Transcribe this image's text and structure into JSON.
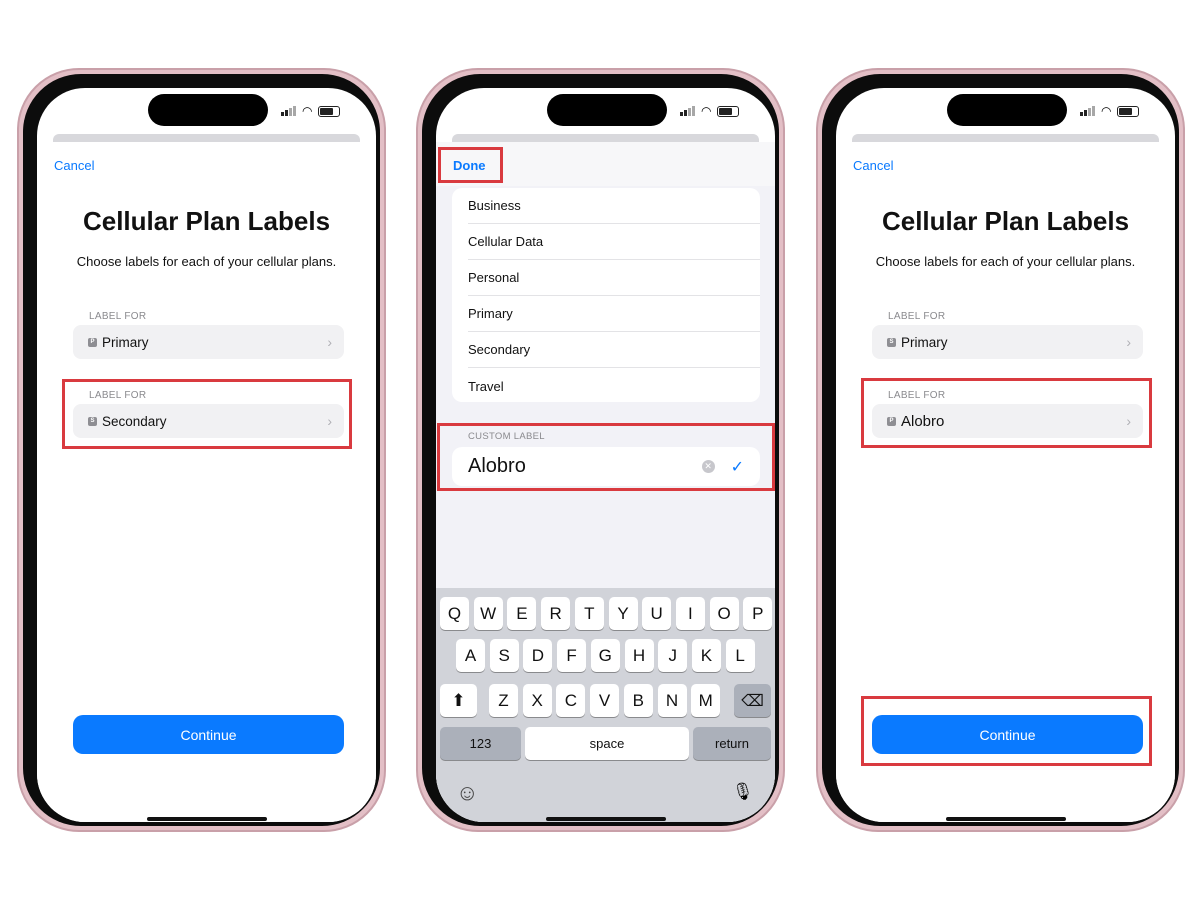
{
  "colors": {
    "accent": "#0a7aff",
    "highlight": "#d93a3f",
    "keyboard": "#d1d3d9"
  },
  "screen1": {
    "cancel": "Cancel",
    "title": "Cellular Plan Labels",
    "subtitle": "Choose labels for each of your cellular plans.",
    "plans": [
      {
        "header": "LABEL FOR",
        "badge": "P",
        "label": "Primary"
      },
      {
        "header": "LABEL FOR",
        "badge": "S",
        "label": "Secondary"
      }
    ],
    "continue": "Continue"
  },
  "screen2": {
    "done": "Done",
    "options": [
      "Business",
      "Cellular Data",
      "Personal",
      "Primary",
      "Secondary",
      "Travel"
    ],
    "custom_header": "CUSTOM LABEL",
    "custom_value": "Alobro",
    "keyboard": {
      "row1": [
        "Q",
        "W",
        "E",
        "R",
        "T",
        "Y",
        "U",
        "I",
        "O",
        "P"
      ],
      "row2": [
        "A",
        "S",
        "D",
        "F",
        "G",
        "H",
        "J",
        "K",
        "L"
      ],
      "row3": [
        "Z",
        "X",
        "C",
        "V",
        "B",
        "N",
        "M"
      ],
      "numbers": "123",
      "space": "space",
      "return": "return",
      "shift_icon": "⬆",
      "delete_icon": "⌫",
      "emoji_icon": "☺",
      "mic_icon": "🎙"
    }
  },
  "screen3": {
    "cancel": "Cancel",
    "title": "Cellular Plan Labels",
    "subtitle": "Choose labels for each of your cellular plans.",
    "plans": [
      {
        "header": "LABEL FOR",
        "badge": "S",
        "label": "Primary"
      },
      {
        "header": "LABEL FOR",
        "badge": "P",
        "label": "Alobro"
      }
    ],
    "continue": "Continue"
  }
}
